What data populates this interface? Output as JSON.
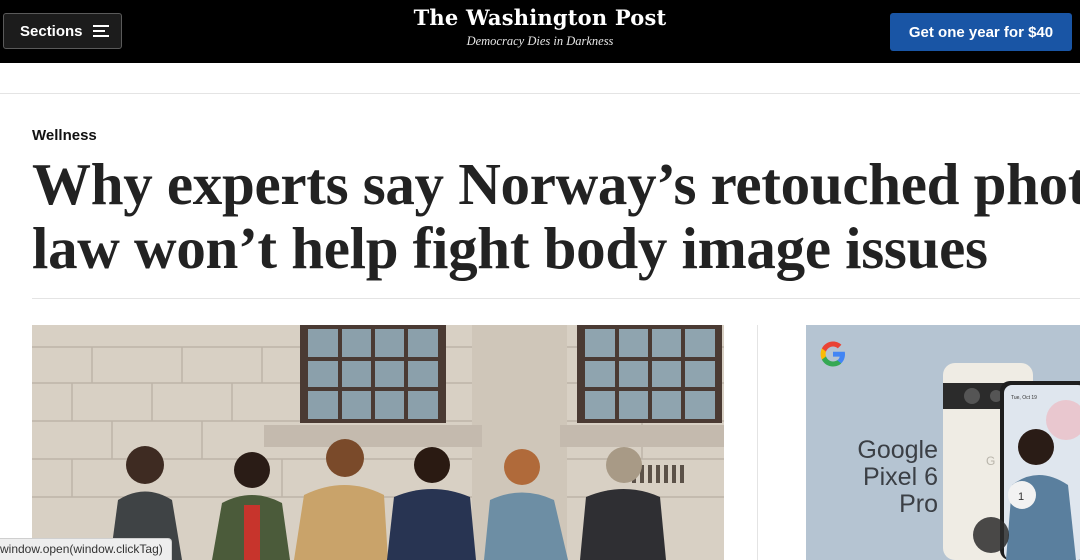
{
  "header": {
    "sections_label": "Sections",
    "logo_text": "The Washington Post",
    "tagline": "Democracy Dies in Darkness",
    "subscribe_label": "Get one year for $40"
  },
  "article": {
    "kicker": "Wellness",
    "headline_line1": "Why experts say Norway’s retouched photo",
    "headline_line2": "law won’t help fight body image issues"
  },
  "ad": {
    "brand_icon": "google-g-icon",
    "product_line1": "Google",
    "product_line2": "Pixel 6 Pro",
    "phone_date": "Tue, Oct 19"
  },
  "status_bar": {
    "text": "window.open(window.clickTag)"
  },
  "colors": {
    "header_bg": "#000000",
    "subscribe_bg": "#1955a5",
    "ad_bg": "#b5c4d2"
  }
}
